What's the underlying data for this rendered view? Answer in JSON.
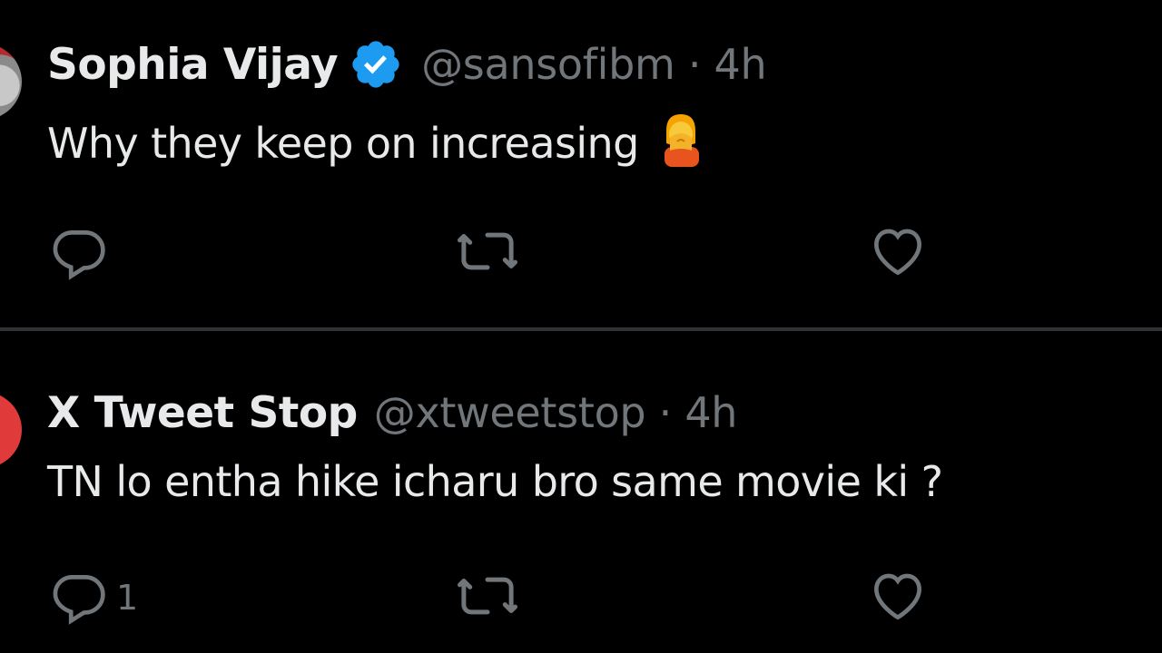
{
  "tweets": [
    {
      "display_name": "Sophia Vijay",
      "verified": true,
      "handle": "@sansofibm",
      "separator": "·",
      "time": "4h",
      "text": "Why they keep on increasing",
      "emoji": "face-palm-emoji",
      "reply_count": "",
      "retweet_count": "",
      "like_count": ""
    },
    {
      "display_name": "X Tweet Stop",
      "verified": false,
      "handle": "@xtweetstop",
      "separator": "·",
      "time": "4h",
      "text": "TN lo entha hike icharu bro same movie ki ?",
      "reply_count": "1",
      "retweet_count": "",
      "like_count": ""
    }
  ],
  "colors": {
    "background": "#000000",
    "primary_text": "#e7e9ea",
    "secondary_text": "#71767b",
    "divider": "#2f3336",
    "verified_badge": "#1d9bf0"
  },
  "icons": {
    "reply": "reply-icon",
    "retweet": "retweet-icon",
    "like": "heart-icon",
    "verified": "verified-badge-icon"
  }
}
